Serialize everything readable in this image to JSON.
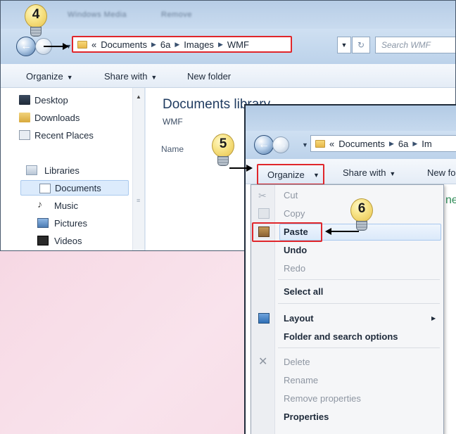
{
  "window1": {
    "title_blurred_1": "Windows Media",
    "title_blurred_2": "Remove",
    "address_prefix": "«",
    "breadcrumb": [
      "Documents",
      "6a",
      "Images",
      "WMF"
    ],
    "search_placeholder": "Search WMF",
    "toolbar": {
      "organize": "Organize",
      "share_with": "Share with",
      "new_folder": "New folder"
    },
    "sidebar": [
      {
        "label": "Desktop",
        "icon": "desktop-icon"
      },
      {
        "label": "Downloads",
        "icon": "downloads-folder-icon"
      },
      {
        "label": "Recent Places",
        "icon": "recent-places-icon"
      },
      {
        "label": "Libraries",
        "icon": "libraries-icon"
      },
      {
        "label": "Documents",
        "icon": "documents-icon"
      },
      {
        "label": "Music",
        "icon": "music-icon"
      },
      {
        "label": "Pictures",
        "icon": "pictures-icon"
      },
      {
        "label": "Videos",
        "icon": "videos-icon"
      }
    ],
    "library_title": "Documents library",
    "library_subtitle": "WMF",
    "column_name": "Name"
  },
  "window2": {
    "address_prefix": "«",
    "breadcrumb": [
      "Documents",
      "6a",
      "Im"
    ],
    "toolbar": {
      "organize": "Organize",
      "share_with": "Share with",
      "new_folder": "New fo"
    },
    "cropped_text": "ne",
    "menu": {
      "cut": "Cut",
      "copy": "Copy",
      "paste": "Paste",
      "undo": "Undo",
      "redo": "Redo",
      "select_all": "Select all",
      "layout": "Layout",
      "folder_search_options": "Folder and search options",
      "delete": "Delete",
      "rename": "Rename",
      "remove_properties": "Remove properties",
      "properties": "Properties"
    }
  },
  "callouts": {
    "step4": "4",
    "step5": "5",
    "step6": "6"
  },
  "colors": {
    "highlight_red": "#e0262b",
    "bulb_yellow": "#f8e58a",
    "window_blue": "#bcd2ea"
  }
}
